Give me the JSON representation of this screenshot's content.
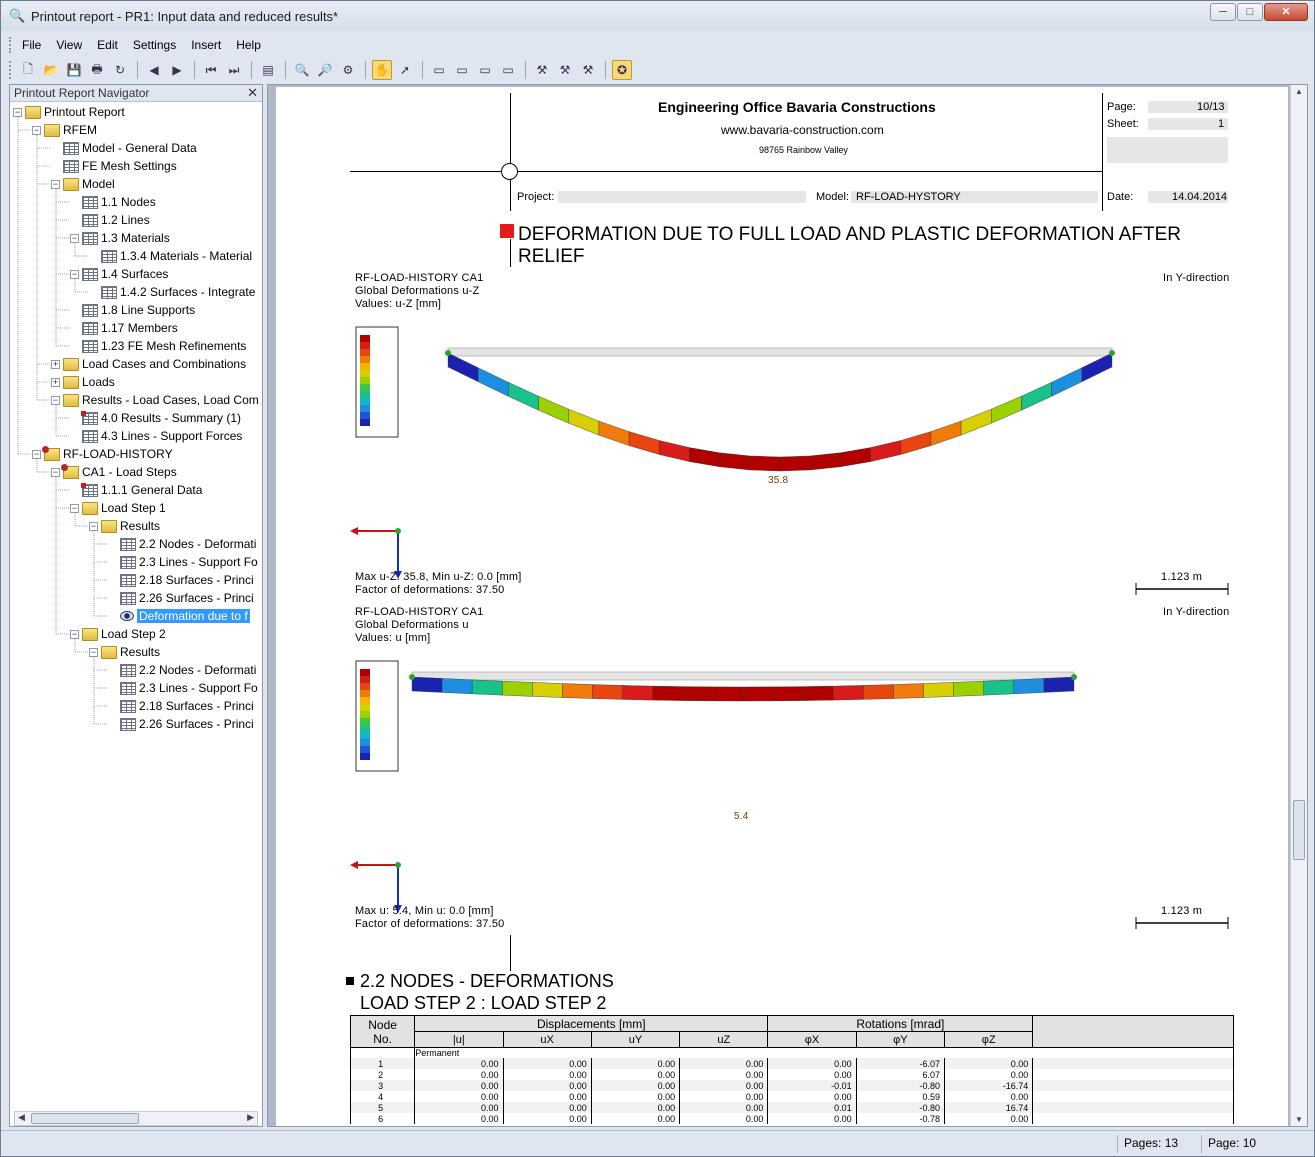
{
  "window": {
    "title": "Printout report - PR1: Input data and reduced results*",
    "controls": {
      "minimize": "─",
      "maximize": "□",
      "close": "✕"
    }
  },
  "menu": [
    "File",
    "View",
    "Edit",
    "Settings",
    "Insert",
    "Help"
  ],
  "toolbar": {
    "icons": [
      "new-icon",
      "open-icon",
      "save-icon",
      "print-icon",
      "refresh-icon",
      "prev-icon",
      "next-icon",
      "first-icon",
      "last-icon",
      "page-setup-icon",
      "zoom-icon",
      "find-icon",
      "settings-icon",
      "select-icon",
      "pointer-icon",
      "page1-icon",
      "page2-icon",
      "page3-icon",
      "page4-icon",
      "tool1-icon",
      "tool2-icon",
      "tool3-icon",
      "help-icon"
    ]
  },
  "navigator": {
    "title": "Printout Report Navigator",
    "close": "✕",
    "items": [
      {
        "label": "Printout Report",
        "level": 0,
        "icon": "folder",
        "exp": "−"
      },
      {
        "label": "RFEM",
        "level": 1,
        "icon": "folder",
        "exp": "−"
      },
      {
        "label": "Model - General Data",
        "level": 2,
        "icon": "table",
        "exp": ""
      },
      {
        "label": "FE Mesh Settings",
        "level": 2,
        "icon": "table",
        "exp": ""
      },
      {
        "label": "Model",
        "level": 2,
        "icon": "folder",
        "exp": "−"
      },
      {
        "label": "1.1 Nodes",
        "level": 3,
        "icon": "table",
        "exp": ""
      },
      {
        "label": "1.2 Lines",
        "level": 3,
        "icon": "table",
        "exp": ""
      },
      {
        "label": "1.3 Materials",
        "level": 3,
        "icon": "table",
        "exp": "−"
      },
      {
        "label": "1.3.4 Materials - Material",
        "level": 4,
        "icon": "table",
        "exp": ""
      },
      {
        "label": "1.4 Surfaces",
        "level": 3,
        "icon": "table",
        "exp": "−"
      },
      {
        "label": "1.4.2 Surfaces - Integrate",
        "level": 4,
        "icon": "table",
        "exp": ""
      },
      {
        "label": "1.8 Line Supports",
        "level": 3,
        "icon": "table",
        "exp": ""
      },
      {
        "label": "1.17 Members",
        "level": 3,
        "icon": "table",
        "exp": ""
      },
      {
        "label": "1.23 FE Mesh Refinements",
        "level": 3,
        "icon": "table",
        "exp": ""
      },
      {
        "label": "Load Cases and Combinations",
        "level": 2,
        "icon": "folder",
        "exp": "+"
      },
      {
        "label": "Loads",
        "level": 2,
        "icon": "folder",
        "exp": "+"
      },
      {
        "label": "Results - Load Cases, Load Com",
        "level": 2,
        "icon": "folder",
        "exp": "−"
      },
      {
        "label": "4.0 Results - Summary (1)",
        "level": 3,
        "icon": "table-red",
        "exp": ""
      },
      {
        "label": "4.3 Lines - Support Forces",
        "level": 3,
        "icon": "table",
        "exp": ""
      },
      {
        "label": "RF-LOAD-HISTORY",
        "level": 1,
        "icon": "folder-rf",
        "exp": "−"
      },
      {
        "label": "CA1 - Load Steps",
        "level": 2,
        "icon": "folder-rf",
        "exp": "−"
      },
      {
        "label": "1.1.1 General Data",
        "level": 3,
        "icon": "table-red",
        "exp": ""
      },
      {
        "label": "Load Step 1",
        "level": 3,
        "icon": "folder",
        "exp": "−"
      },
      {
        "label": "Results",
        "level": 4,
        "icon": "folder",
        "exp": "−"
      },
      {
        "label": "2.2 Nodes - Deformati",
        "level": 5,
        "icon": "table",
        "exp": ""
      },
      {
        "label": "2.3 Lines - Support Fo",
        "level": 5,
        "icon": "table",
        "exp": ""
      },
      {
        "label": "2.18 Surfaces - Princi",
        "level": 5,
        "icon": "table",
        "exp": ""
      },
      {
        "label": "2.26 Surfaces - Princi",
        "level": 5,
        "icon": "table",
        "exp": ""
      },
      {
        "label": "Deformation due to f",
        "level": 5,
        "icon": "eye",
        "exp": "",
        "selected": true
      },
      {
        "label": "Load Step 2",
        "level": 3,
        "icon": "folder",
        "exp": "−"
      },
      {
        "label": "Results",
        "level": 4,
        "icon": "folder",
        "exp": "−"
      },
      {
        "label": "2.2 Nodes - Deformati",
        "level": 5,
        "icon": "table",
        "exp": ""
      },
      {
        "label": "2.3 Lines - Support Fo",
        "level": 5,
        "icon": "table",
        "exp": ""
      },
      {
        "label": "2.18 Surfaces - Princi",
        "level": 5,
        "icon": "table",
        "exp": ""
      },
      {
        "label": "2.26 Surfaces - Princi",
        "level": 5,
        "icon": "table",
        "exp": ""
      }
    ]
  },
  "page": {
    "company": "Engineering Office Bavaria Constructions",
    "website": "www.bavaria-construction.com",
    "address": "98765 Rainbow Valley",
    "page_label": "Page:",
    "page_value": "10/13",
    "sheet_label": "Sheet:",
    "sheet_value": "1",
    "project_label": "Project:",
    "project_value": "",
    "model_label": "Model:",
    "model_value": "RF-LOAD-HYSTORY",
    "date_label": "Date:",
    "date_value": "14.04.2014",
    "section_title_1": "DEFORMATION DUE TO FULL LOAD AND PLASTIC DEFORMATION AFTER",
    "section_title_2": "RELIEF",
    "figure1": {
      "line1": "RF-LOAD-HISTORY CA1",
      "line2": "Global Deformations u-Z",
      "line3": "Values: u-Z [mm]",
      "direction": "In Y-direction",
      "max_label": "35.8",
      "footer1": "Max u-Z: 35.8, Min u-Z: 0.0 [mm]",
      "footer2": "Factor of deformations: 37.50",
      "scale": "1.123 m"
    },
    "figure2": {
      "line1": "RF-LOAD-HISTORY CA1",
      "line2": "Global Deformations u",
      "line3": "Values: u [mm]",
      "direction": "In Y-direction",
      "max_label": "5.4",
      "footer1": "Max u: 5.4, Min u: 0.0 [mm]",
      "footer2": "Factor of deformations: 37.50",
      "scale": "1.123 m"
    },
    "section2_title_1": "2.2 NODES - DEFORMATIONS",
    "section2_title_2": "LOAD STEP 2 : LOAD STEP 2",
    "table": {
      "h_node": "Node",
      "h_no": "No.",
      "h_disp": "Displacements [mm]",
      "h_rot": "Rotations [mrad]",
      "cols": [
        "|u|",
        "uX",
        "uY",
        "uZ",
        "φX",
        "φY",
        "φZ"
      ],
      "group": "Permanent",
      "rows": [
        [
          "1",
          "0.00",
          "0.00",
          "0.00",
          "0.00",
          "0.00",
          "-6.07",
          "0.00"
        ],
        [
          "2",
          "0.00",
          "0.00",
          "0.00",
          "0.00",
          "0.00",
          "6.07",
          "0.00"
        ],
        [
          "3",
          "0.00",
          "0.00",
          "0.00",
          "0.00",
          "-0.01",
          "-0.80",
          "-16.74"
        ],
        [
          "4",
          "0.00",
          "0.00",
          "0.00",
          "0.00",
          "0.00",
          "0.59",
          "0.00"
        ],
        [
          "5",
          "0.00",
          "0.00",
          "0.00",
          "0.00",
          "0.01",
          "-0.80",
          "16.74"
        ],
        [
          "6",
          "0.00",
          "0.00",
          "0.00",
          "0.00",
          "0.00",
          "-0.78",
          "0.00"
        ]
      ]
    }
  },
  "status": {
    "pages": "Pages: 13",
    "page": "Page: 10"
  }
}
